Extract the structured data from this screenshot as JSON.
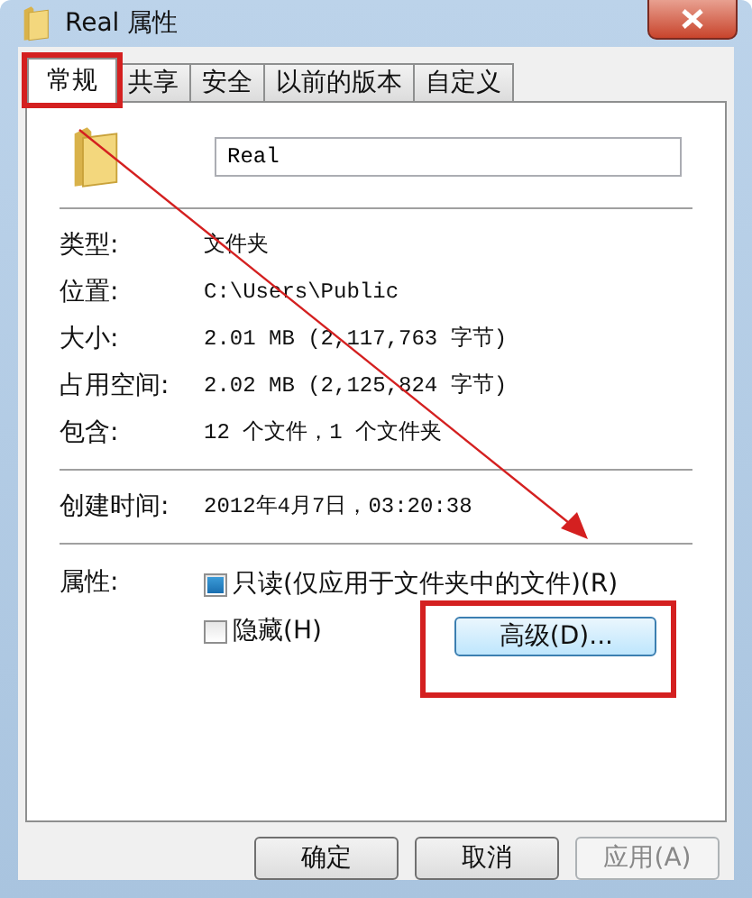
{
  "window": {
    "title": "Real 属性"
  },
  "tabs": [
    {
      "label": "常规",
      "selected": true,
      "highlighted": true
    },
    {
      "label": "共享",
      "selected": false,
      "highlighted": false
    },
    {
      "label": "安全",
      "selected": false,
      "highlighted": false
    },
    {
      "label": "以前的版本",
      "selected": false,
      "highlighted": false
    },
    {
      "label": "自定义",
      "selected": false,
      "highlighted": false
    }
  ],
  "name_field": {
    "value": "Real"
  },
  "info_groups": [
    [
      {
        "label": "类型:",
        "value": "文件夹"
      },
      {
        "label": "位置:",
        "value": "C:\\Users\\Public"
      },
      {
        "label": "大小:",
        "value": "2.01 MB (2,117,763 字节)"
      },
      {
        "label": "占用空间:",
        "value": "2.02 MB (2,125,824 字节)"
      },
      {
        "label": "包含:",
        "value": "12 个文件，1 个文件夹"
      }
    ],
    [
      {
        "label": "创建时间:",
        "value": "2012年4月7日，03:20:38"
      }
    ]
  ],
  "attributes": {
    "label": "属性:",
    "checkboxes": [
      {
        "label": "只读(仅应用于文件夹中的文件)(R)",
        "checked": false,
        "mixed": true
      },
      {
        "label": "隐藏(H)",
        "checked": false,
        "mixed": false
      }
    ],
    "advanced_button": {
      "label": "高级(D)...",
      "highlighted": true
    }
  },
  "annotation_arrow": true,
  "buttons": [
    {
      "label": "确定",
      "disabled": false
    },
    {
      "label": "取消",
      "disabled": false
    },
    {
      "label": "应用(A)",
      "disabled": true
    }
  ]
}
